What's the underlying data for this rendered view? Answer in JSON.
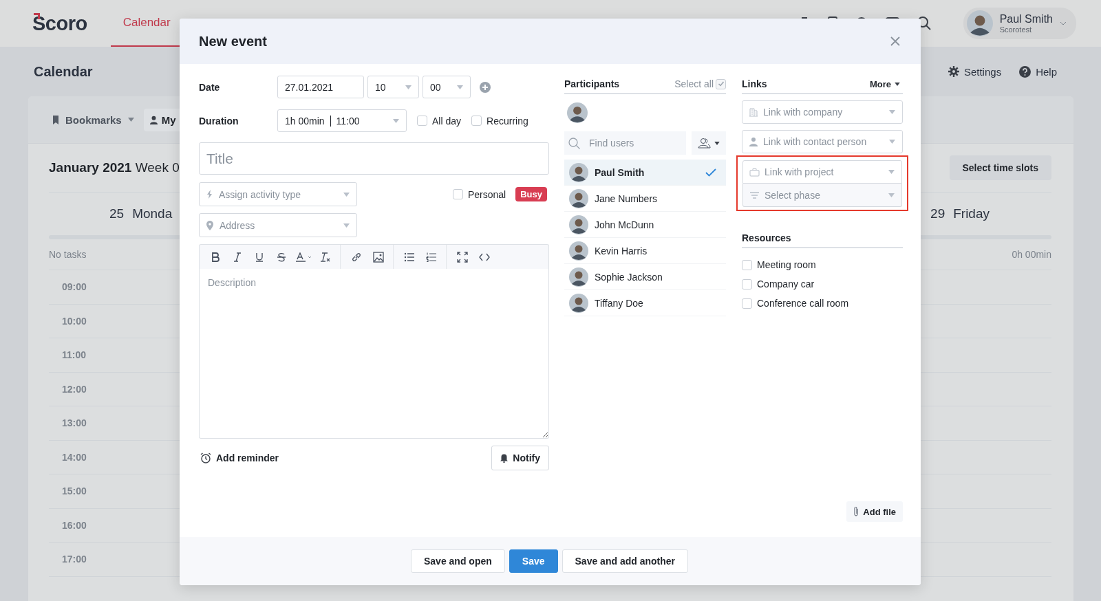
{
  "app": {
    "logo": "Scoro",
    "nav": [
      {
        "label": "Calendar",
        "selected": true
      }
    ],
    "user": {
      "name": "Paul Smith",
      "company": "Scorotest"
    }
  },
  "page": {
    "title": "Calendar",
    "actions": [
      {
        "label": "Settings",
        "kind": "settings"
      },
      {
        "label": "Help",
        "kind": "help"
      }
    ],
    "toolbar": {
      "bookmarks": "Bookmarks",
      "view": "My"
    },
    "period": {
      "month": "January 2021",
      "week": "Week 0"
    },
    "select_slots": "Select time slots",
    "days": [
      {
        "number": "25",
        "name": "Monda",
        "summary": "No tasks"
      },
      {
        "number": "29",
        "name": "Friday",
        "summary": "0h 00min"
      }
    ],
    "hours": [
      "09:00",
      "10:00",
      "11:00",
      "12:00",
      "13:00",
      "14:00",
      "15:00",
      "16:00",
      "17:00"
    ]
  },
  "dialog": {
    "title": "New event",
    "date": {
      "label": "Date",
      "value": "27.01.2021",
      "hour": "10",
      "minute": "00"
    },
    "duration": {
      "label": "Duration",
      "value": "1h 00min",
      "end": "11:00"
    },
    "options": [
      {
        "label": "All day",
        "checked": false
      },
      {
        "label": "Recurring",
        "checked": false
      }
    ],
    "title_field": {
      "placeholder": "Title"
    },
    "activity_type": {
      "placeholder": "Assign activity type"
    },
    "personal": {
      "label": "Personal",
      "checked": false
    },
    "busy": "Busy",
    "address": {
      "placeholder": "Address"
    },
    "description": {
      "placeholder": "Description"
    },
    "add_reminder": "Add reminder",
    "notify": "Notify",
    "participants": {
      "heading": "Participants",
      "select_all": {
        "label": "Select all",
        "checked": true
      },
      "search": {
        "placeholder": "Find users"
      },
      "users": [
        {
          "name": "Paul Smith",
          "selected": true
        },
        {
          "name": "Jane Numbers",
          "selected": false
        },
        {
          "name": "John McDunn",
          "selected": false
        },
        {
          "name": "Kevin Harris",
          "selected": false
        },
        {
          "name": "Sophie Jackson",
          "selected": false
        },
        {
          "name": "Tiffany Doe",
          "selected": false
        }
      ]
    },
    "links": {
      "heading": "Links",
      "more": "More",
      "fields": [
        {
          "placeholder": "Link with company",
          "kind": "company"
        },
        {
          "placeholder": "Link with contact person",
          "kind": "contact"
        }
      ],
      "highlighted_group": [
        {
          "placeholder": "Link with project",
          "kind": "project"
        },
        {
          "placeholder": "Select phase",
          "kind": "phase"
        }
      ]
    },
    "resources": {
      "heading": "Resources",
      "items": [
        {
          "label": "Meeting room",
          "checked": false
        },
        {
          "label": "Company car",
          "checked": false
        },
        {
          "label": "Conference call room",
          "checked": false
        }
      ]
    },
    "add_file": "Add file",
    "buttons": [
      {
        "label": "Save and open",
        "kind": "secondary"
      },
      {
        "label": "Save",
        "kind": "primary"
      },
      {
        "label": "Save and add another",
        "kind": "secondary"
      }
    ]
  }
}
